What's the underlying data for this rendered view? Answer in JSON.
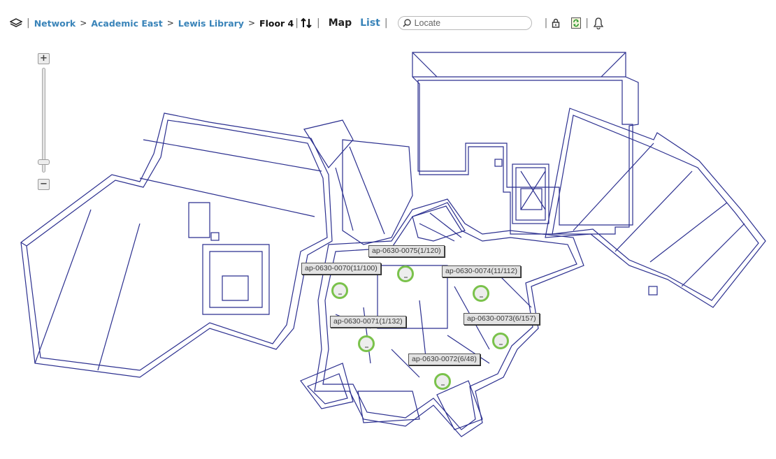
{
  "toolbar": {
    "layers_icon": "layers-icon",
    "breadcrumb": [
      {
        "label": "Network"
      },
      {
        "label": "Academic East"
      },
      {
        "label": "Lewis Library"
      }
    ],
    "breadcrumb_separator": ">",
    "current_floor": "Floor 4",
    "floor_switch_icon": "up-down-arrows-icon",
    "view_map_label": "Map",
    "view_list_label": "List",
    "search_placeholder": "Locate",
    "search_value": "",
    "lock_icon": "lock-icon",
    "refresh_icon": "refresh-icon",
    "bell_icon": "bell-icon"
  },
  "zoom": {
    "in_label": "+",
    "out_label": "−",
    "level": 0.1
  },
  "access_points": [
    {
      "label": "ap-0630-0075(1/120)"
    },
    {
      "label": "ap-0630-0070(11/100)"
    },
    {
      "label": "ap-0630-0074(11/112)"
    },
    {
      "label": "ap-0630-0071(1/132)"
    },
    {
      "label": "ap-0630-0073(6/157)"
    },
    {
      "label": "ap-0630-0072(6/48)"
    }
  ],
  "colors": {
    "link": "#3a84b9",
    "floorplan_line": "#2b2f8f",
    "ap_ring": "#7ac24b"
  }
}
